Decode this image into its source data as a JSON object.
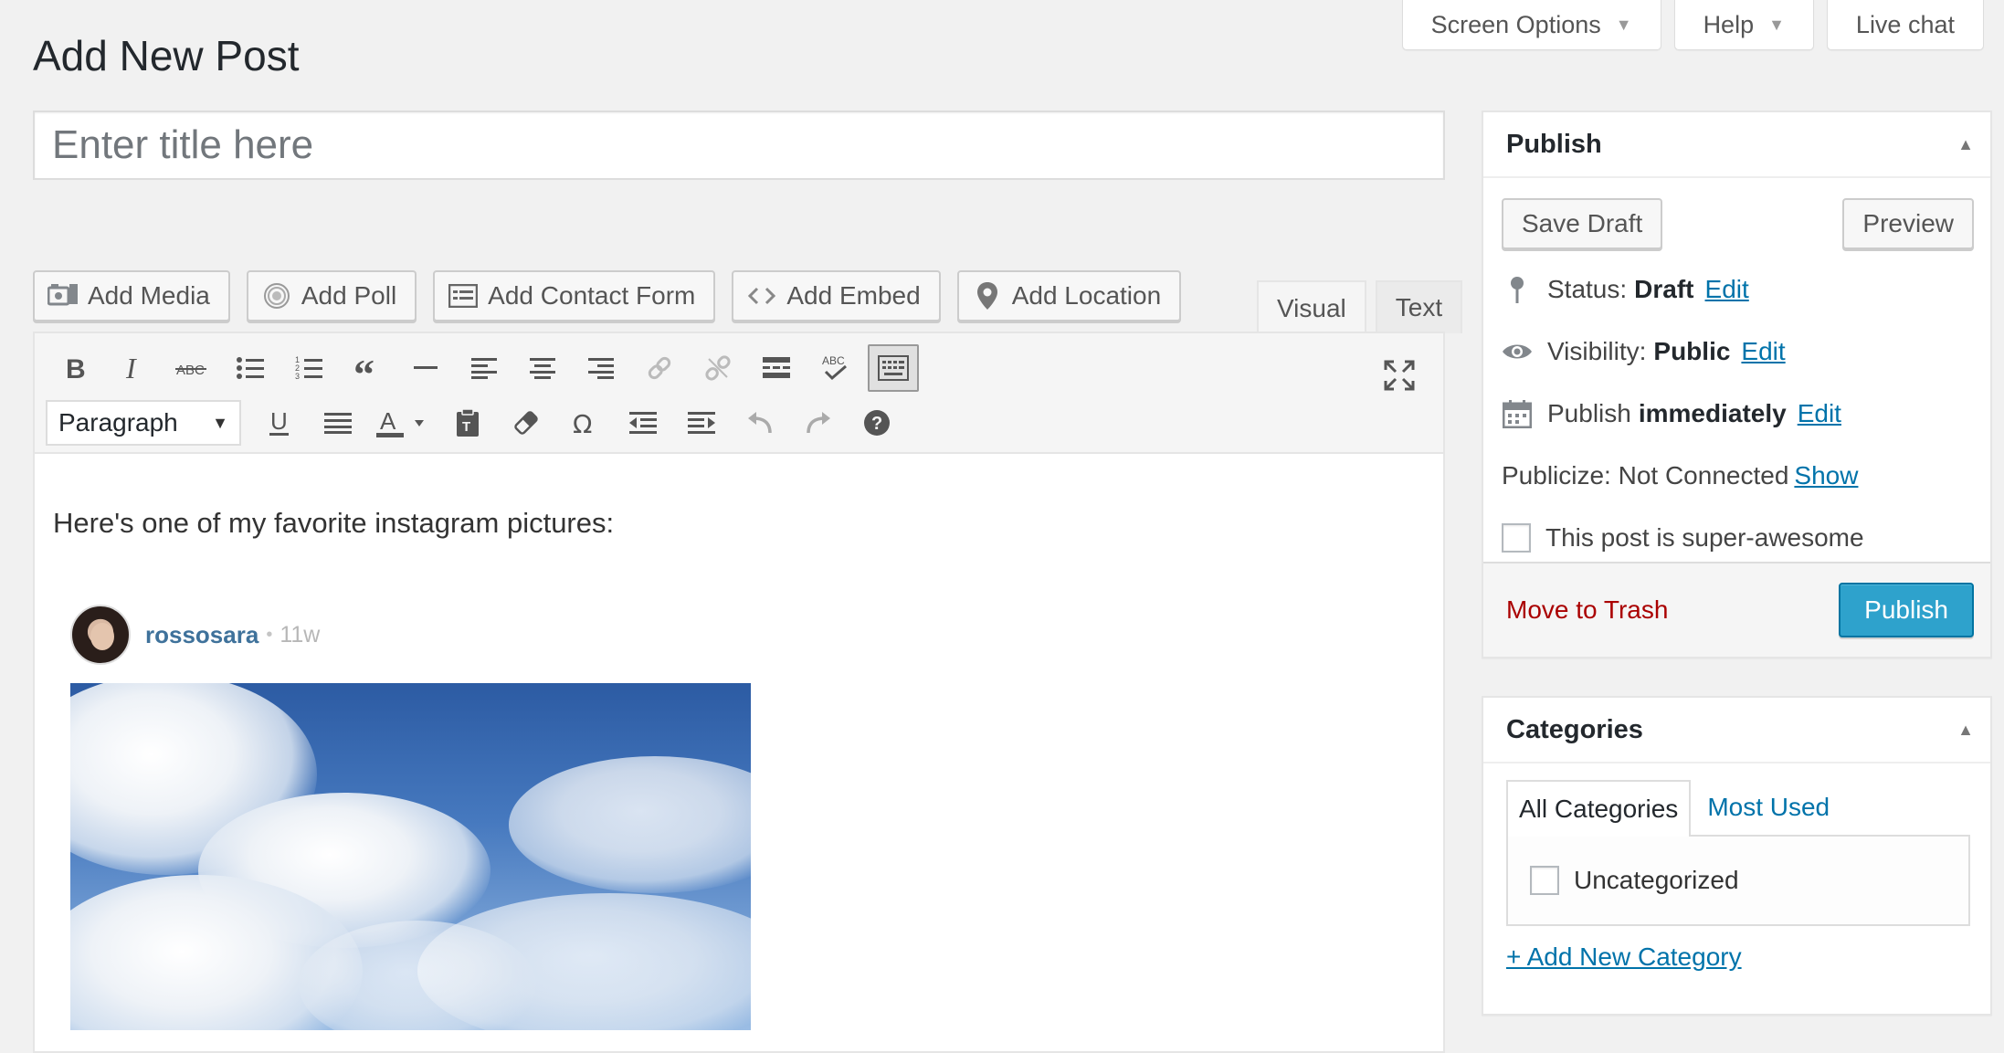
{
  "screen_meta": {
    "screen_options": "Screen Options",
    "help": "Help",
    "live_chat": "Live chat"
  },
  "page_title": "Add New Post",
  "title_placeholder": "Enter title here",
  "media_buttons": {
    "add_media": "Add Media",
    "add_poll": "Add Poll",
    "add_contact_form": "Add Contact Form",
    "add_embed": "Add Embed",
    "add_location": "Add Location"
  },
  "editor_tabs": {
    "visual": "Visual",
    "text": "Text",
    "active": "Visual"
  },
  "toolbar": {
    "format_select": "Paragraph",
    "row1_icons": [
      "bold-icon",
      "italic-icon",
      "strikethrough-icon",
      "bullet-list-icon",
      "numbered-list-icon",
      "blockquote-icon",
      "horizontal-rule-icon",
      "align-left-icon",
      "align-center-icon",
      "align-right-icon",
      "insert-link-icon",
      "remove-link-icon",
      "read-more-icon",
      "spellcheck-icon",
      "toolbar-toggle-icon"
    ],
    "row2_icons": [
      "underline-icon",
      "justify-icon",
      "text-color-icon",
      "paste-text-icon",
      "clear-formatting-icon",
      "special-character-icon",
      "outdent-icon",
      "indent-icon",
      "undo-icon",
      "redo-icon",
      "help-icon"
    ],
    "fullscreen_icon": "distraction-free-icon"
  },
  "content": {
    "paragraph": "Here's one of my favorite instagram pictures:",
    "instagram": {
      "username": "rossosara",
      "separator": "•",
      "time": "11w"
    }
  },
  "publish": {
    "title": "Publish",
    "save_draft": "Save Draft",
    "preview": "Preview",
    "status_label": "Status:",
    "status_value": "Draft",
    "visibility_label": "Visibility:",
    "visibility_value": "Public",
    "schedule_label": "Publish",
    "schedule_value": "immediately",
    "edit": "Edit",
    "publicize_label": "Publicize: Not Connected",
    "publicize_show": "Show",
    "super_awesome": "This post is super-awesome",
    "move_to_trash": "Move to Trash",
    "publish_button": "Publish"
  },
  "categories": {
    "title": "Categories",
    "tab_all": "All Categories",
    "tab_most_used": "Most Used",
    "items": [
      "Uncategorized"
    ],
    "add_new": "+ Add New Category"
  },
  "colors": {
    "link": "#0073aa",
    "publish_button": "#2ea2cc",
    "trash": "#aa0000",
    "instagram_user": "#3f729b"
  }
}
